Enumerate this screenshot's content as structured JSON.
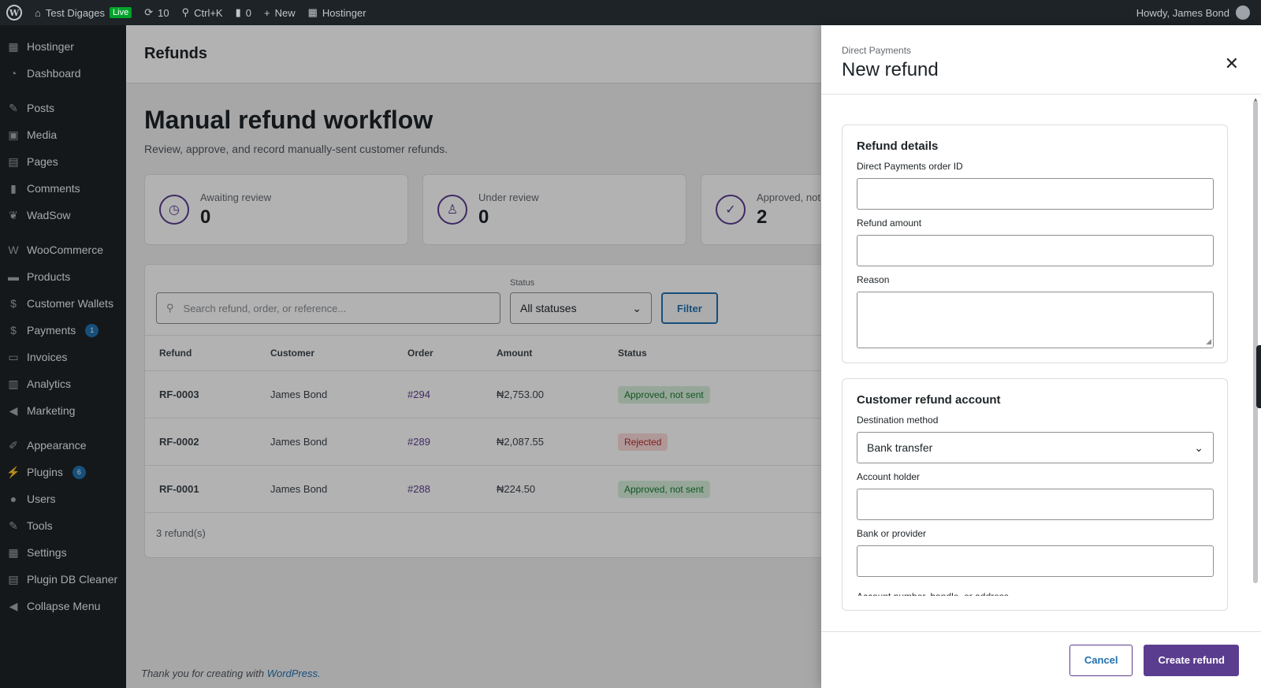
{
  "adminbar": {
    "site_name": "Test Digages",
    "live_badge": "Live",
    "updates_count": "10",
    "shortcut": "Ctrl+K",
    "comments_count": "0",
    "new_label": "New",
    "hostinger_label": "Hostinger",
    "greeting": "Howdy, James Bond"
  },
  "sidebar": {
    "items": [
      {
        "label": "Hostinger",
        "icon": "hostinger-icon"
      },
      {
        "label": "Dashboard",
        "icon": "dashboard-icon"
      },
      {
        "label": "Posts",
        "icon": "pin-icon"
      },
      {
        "label": "Media",
        "icon": "media-icon"
      },
      {
        "label": "Pages",
        "icon": "pages-icon"
      },
      {
        "label": "Comments",
        "icon": "comment-icon"
      },
      {
        "label": "WadSow",
        "icon": "leaf-icon"
      },
      {
        "label": "WooCommerce",
        "icon": "woo-icon"
      },
      {
        "label": "Products",
        "icon": "products-icon"
      },
      {
        "label": "Customer Wallets",
        "icon": "dollar-icon"
      },
      {
        "label": "Payments",
        "icon": "payments-icon",
        "badge": "1"
      },
      {
        "label": "Invoices",
        "icon": "invoices-icon"
      },
      {
        "label": "Analytics",
        "icon": "analytics-icon"
      },
      {
        "label": "Marketing",
        "icon": "megaphone-icon"
      },
      {
        "label": "Appearance",
        "icon": "brush-icon"
      },
      {
        "label": "Plugins",
        "icon": "plug-icon",
        "badge": "6"
      },
      {
        "label": "Users",
        "icon": "user-icon"
      },
      {
        "label": "Tools",
        "icon": "wrench-icon"
      },
      {
        "label": "Settings",
        "icon": "settings-icon"
      },
      {
        "label": "Plugin DB Cleaner",
        "icon": "database-icon"
      },
      {
        "label": "Collapse Menu",
        "icon": "collapse-icon"
      }
    ]
  },
  "page": {
    "header_title": "Refunds",
    "hero_title": "Manual refund workflow",
    "hero_subtitle": "Review, approve, and record manually-sent customer refunds."
  },
  "cards": [
    {
      "label": "Awaiting review",
      "value": "0",
      "icon": "clock-icon"
    },
    {
      "label": "Under review",
      "value": "0",
      "icon": "person-icon"
    },
    {
      "label": "Approved, not sent",
      "value": "2",
      "icon": "check-icon"
    }
  ],
  "filters": {
    "search_placeholder": "Search refund, order, or reference...",
    "status_label": "Status",
    "status_value": "All statuses",
    "filter_button": "Filter"
  },
  "table": {
    "headers": [
      "Refund",
      "Customer",
      "Order",
      "Amount",
      "Status"
    ],
    "rows": [
      {
        "refund": "RF-0003",
        "customer": "James Bond",
        "order": "#294",
        "amount": "₦2,753.00",
        "status": "Approved, not sent"
      },
      {
        "refund": "RF-0002",
        "customer": "James Bond",
        "order": "#289",
        "amount": "₦2,087.55",
        "status": "Rejected"
      },
      {
        "refund": "RF-0001",
        "customer": "James Bond",
        "order": "#288",
        "amount": "₦224.50",
        "status": "Approved, not sent"
      }
    ],
    "footer": "3 refund(s)"
  },
  "footer": {
    "text": "Thank you for creating with",
    "link": "WordPress."
  },
  "drawer": {
    "subtitle": "Direct Payments",
    "title": "New refund",
    "close_icon": "close-icon",
    "section1": {
      "title": "Refund details",
      "order_id_label": "Direct Payments order ID",
      "amount_label": "Refund amount",
      "reason_label": "Reason"
    },
    "section2": {
      "title": "Customer refund account",
      "method_label": "Destination method",
      "method_value": "Bank transfer",
      "holder_label": "Account holder",
      "bank_label": "Bank or provider",
      "next_label": "Account number, handle, or address"
    },
    "cancel_button": "Cancel",
    "create_button": "Create refund"
  }
}
